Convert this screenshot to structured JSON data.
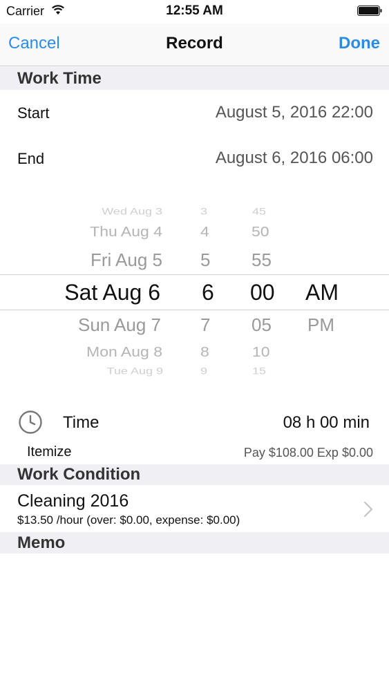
{
  "status_bar": {
    "carrier": "Carrier",
    "time": "12:55 AM"
  },
  "nav": {
    "cancel": "Cancel",
    "title": "Record",
    "done": "Done"
  },
  "work_time": {
    "header": "Work Time",
    "start_label": "Start",
    "start_value": "August 5, 2016 22:00",
    "end_label": "End",
    "end_value": "August 6, 2016 06:00"
  },
  "picker": {
    "dates": [
      "Wed Aug 3",
      "Thu Aug 4",
      "Fri Aug 5",
      "Sat Aug 6",
      "Sun Aug 7",
      "Mon Aug 8",
      "Tue Aug 9"
    ],
    "hours": [
      "3",
      "4",
      "5",
      "6",
      "7",
      "8",
      "9"
    ],
    "minutes": [
      "45",
      "50",
      "55",
      "00",
      "05",
      "10",
      "15"
    ],
    "meridiem": [
      "AM",
      "PM"
    ]
  },
  "time_summary": {
    "label": "Time",
    "value": "08 h 00 min",
    "itemize_label": "Itemize",
    "itemize_value": "Pay $108.00 Exp $0.00"
  },
  "work_condition": {
    "header": "Work Condition",
    "name": "Cleaning 2016",
    "detail": "$13.50 /hour (over: $0.00, expense: $0.00)"
  },
  "memo": {
    "header": "Memo"
  },
  "colors": {
    "accent": "#2a8ce6",
    "section_bg": "#efeff4"
  }
}
